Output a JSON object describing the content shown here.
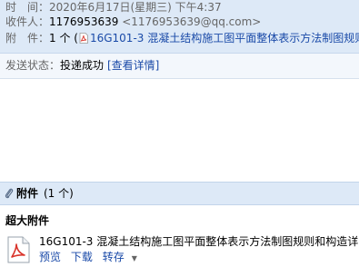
{
  "header": {
    "time_label": "时　间：",
    "time_value": "2020年6月17日(星期三) 下午4:37",
    "to_label": "收件人：",
    "to_name": "1176953639",
    "to_email": "<1176953639@qq.com>",
    "attach_label": "附　件：",
    "attach_count": "1 个 (",
    "attach_file": "16G101-3 混凝土结构施工图平面整体表示方法制图规则"
  },
  "status": {
    "label": "发送状态：",
    "value": "投递成功",
    "link": "[查看详情]"
  },
  "attachments": {
    "title": "附件",
    "count": "(1 个)",
    "big_title": "超大附件",
    "file_name": "16G101-3 混凝土结构施工图平面整体表示方法制图规则和构造详",
    "preview": "预览",
    "download": "下载",
    "forward": "转存"
  },
  "icons": {
    "pdf": "pdf-icon",
    "clip": "paperclip-icon"
  },
  "colors": {
    "header_bg": "#dde9f7",
    "link": "#1a4aa8",
    "pdf_red": "#d9342b"
  }
}
